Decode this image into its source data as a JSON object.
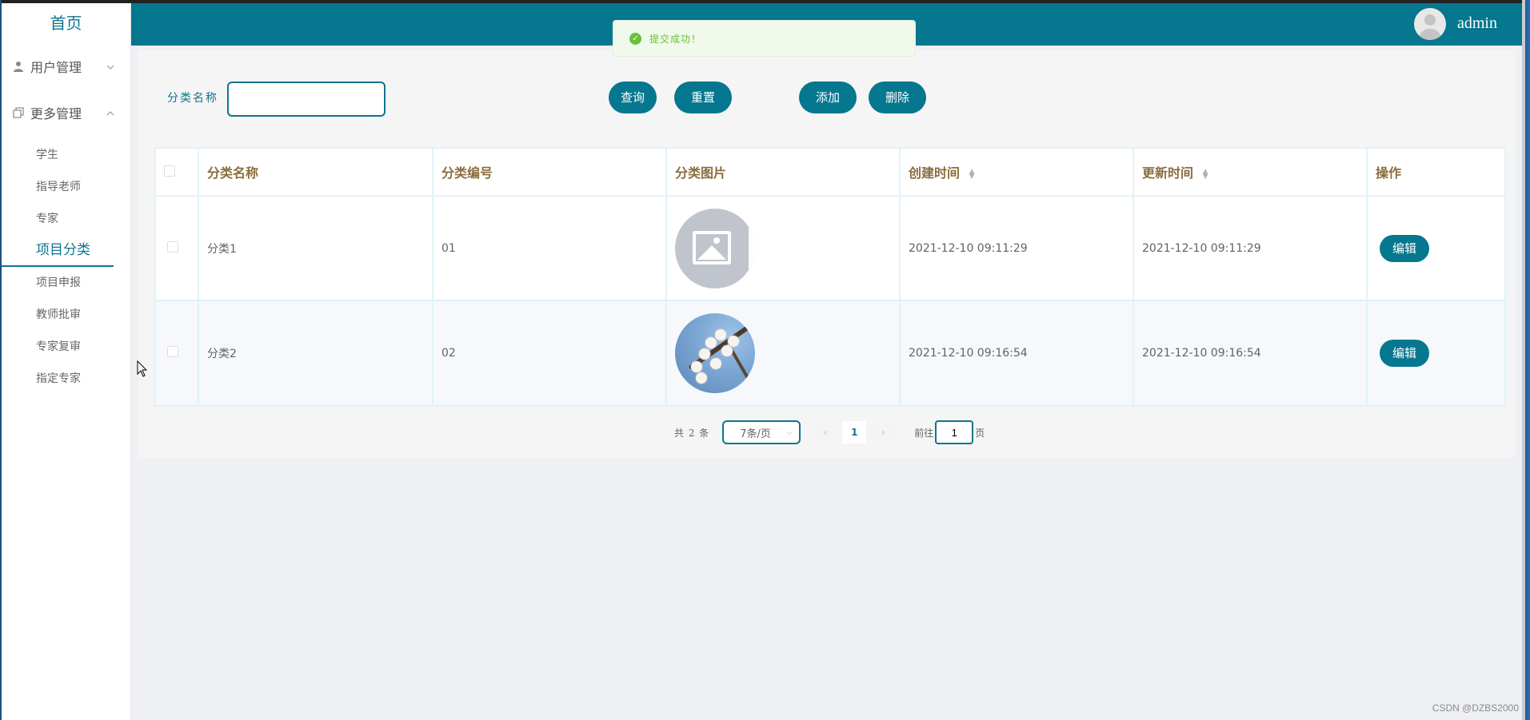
{
  "sidebar": {
    "home": "首页",
    "groups": [
      {
        "label": "用户管理",
        "icon": "user-icon",
        "expanded": false
      },
      {
        "label": "更多管理",
        "icon": "copy-icon",
        "expanded": true
      }
    ],
    "items": [
      {
        "label": "学生",
        "active": false
      },
      {
        "label": "指导老师",
        "active": false
      },
      {
        "label": "专家",
        "active": false
      },
      {
        "label": "项目分类",
        "active": true
      },
      {
        "label": "项目申报",
        "active": false
      },
      {
        "label": "教师批审",
        "active": false
      },
      {
        "label": "专家复审",
        "active": false
      },
      {
        "label": "指定专家",
        "active": false
      }
    ]
  },
  "header": {
    "username": "admin",
    "accent_color": "#05778f"
  },
  "toast": {
    "message": "提交成功！",
    "type": "success"
  },
  "search": {
    "label": "分类名称",
    "value": "",
    "query_button": "查询",
    "reset_button": "重置",
    "add_button": "添加",
    "delete_button": "删除"
  },
  "table": {
    "columns": [
      "分类名称",
      "分类编号",
      "分类图片",
      "创建时间",
      "更新时间",
      "操作"
    ],
    "rows": [
      {
        "name": "分类1",
        "code": "01",
        "image": "placeholder",
        "created": "2021-12-10 09:11:29",
        "updated": "2021-12-10 09:11:29",
        "action": "编辑"
      },
      {
        "name": "分类2",
        "code": "02",
        "image": "blossom-photo",
        "created": "2021-12-10 09:16:54",
        "updated": "2021-12-10 09:16:54",
        "action": "编辑"
      }
    ]
  },
  "pagination": {
    "total": "共 2 条",
    "page_size": "7条/页",
    "prev": "‹",
    "current_page": "1",
    "next": "›",
    "goto_prefix": "前往",
    "goto_value": "1",
    "goto_suffix": "页"
  },
  "watermark": "CSDN @DZBS2000"
}
